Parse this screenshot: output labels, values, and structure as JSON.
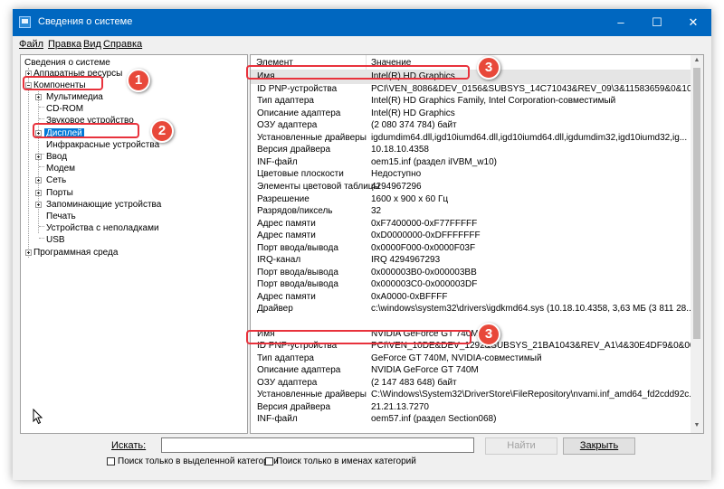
{
  "window": {
    "title": "Сведения о системе",
    "minimize": "–",
    "maximize": "☐",
    "close": "✕"
  },
  "menu": [
    {
      "label": "Файл"
    },
    {
      "label": "Правка"
    },
    {
      "label": "Вид"
    },
    {
      "label": "Справка"
    }
  ],
  "tree": {
    "root": "Сведения о системе",
    "hardware": "Аппаратные ресурсы",
    "components": "Компоненты",
    "multimedia": "Мультимедиа",
    "cdrom": "CD-ROM",
    "sound": "Звуковое устройство",
    "display": "Дисплей",
    "infrared": "Инфракрасные устройства",
    "input": "Ввод",
    "modem": "Модем",
    "network": "Сеть",
    "ports": "Порты",
    "storage": "Запоминающие устройства",
    "print": "Печать",
    "problem": "Устройства с неполадками",
    "usb": "USB",
    "software": "Программная среда"
  },
  "list": {
    "col_element": "Элемент",
    "col_value": "Значение",
    "rows": [
      {
        "k": "Имя",
        "v": "Intel(R) HD Graphics"
      },
      {
        "k": "ID PNP-устройства",
        "v": "PCI\\VEN_8086&DEV_0156&SUBSYS_14C71043&REV_09\\3&11583659&0&10"
      },
      {
        "k": "Тип адаптера",
        "v": "Intel(R) HD Graphics Family, Intel Corporation-совместимый"
      },
      {
        "k": "Описание адаптера",
        "v": "Intel(R) HD Graphics"
      },
      {
        "k": "ОЗУ адаптера",
        "v": "(2 080 374 784) байт"
      },
      {
        "k": "Установленные драйверы",
        "v": "igdumdim64.dll,igd10iumd64.dll,igd10iumd64.dll,igdumdim32,igd10iumd32,ig..."
      },
      {
        "k": "Версия драйвера",
        "v": "10.18.10.4358"
      },
      {
        "k": "INF-файл",
        "v": "oem15.inf (раздел iIVBM_w10)"
      },
      {
        "k": "Цветовые плоскости",
        "v": "Недоступно"
      },
      {
        "k": "Элементы цветовой таблицы",
        "v": "4294967296"
      },
      {
        "k": "Разрешение",
        "v": "1600 x 900 x 60 Гц"
      },
      {
        "k": "Разрядов/пиксель",
        "v": "32"
      },
      {
        "k": "Адрес памяти",
        "v": "0xF7400000-0xF77FFFFF"
      },
      {
        "k": "Адрес памяти",
        "v": "0xD0000000-0xDFFFFFFF"
      },
      {
        "k": "Порт ввода/вывода",
        "v": "0x0000F000-0x0000F03F"
      },
      {
        "k": "IRQ-канал",
        "v": "IRQ 4294967293"
      },
      {
        "k": "Порт ввода/вывода",
        "v": "0x000003B0-0x000003BB"
      },
      {
        "k": "Порт ввода/вывода",
        "v": "0x000003C0-0x000003DF"
      },
      {
        "k": "Адрес памяти",
        "v": "0xA0000-0xBFFFF"
      },
      {
        "k": "Драйвер",
        "v": "c:\\windows\\system32\\drivers\\igdkmd64.sys (10.18.10.4358, 3,63 МБ (3 811 28..."
      },
      {
        "k": "",
        "v": ""
      },
      {
        "k": "Имя",
        "v": "NVIDIA GeForce GT 740M"
      },
      {
        "k": "ID PNP-устройства",
        "v": "PCI\\VEN_10DE&DEV_1292&SUBSYS_21BA1043&REV_A1\\4&30E4DF9&0&0008"
      },
      {
        "k": "Тип адаптера",
        "v": "GeForce GT 740M, NVIDIA-совместимый"
      },
      {
        "k": "Описание адаптера",
        "v": "NVIDIA GeForce GT 740M"
      },
      {
        "k": "ОЗУ адаптера",
        "v": "(2 147 483 648) байт"
      },
      {
        "k": "Установленные драйверы",
        "v": "C:\\Windows\\System32\\DriverStore\\FileRepository\\nvami.inf_amd64_fd2cdd92c..."
      },
      {
        "k": "Версия драйвера",
        "v": "21.21.13.7270"
      },
      {
        "k": "INF-файл",
        "v": "oem57.inf (раздел Section068)"
      }
    ]
  },
  "search": {
    "label": "Искать:",
    "value": "",
    "find": "Найти",
    "close": "Закрыть"
  },
  "options": {
    "only_selected": "Поиск только в выделенной категории",
    "only_names": "Поиск только в именах категорий"
  },
  "annotations": {
    "n1": "1",
    "n2": "2",
    "n3a": "3",
    "n3b": "3"
  },
  "colors": {
    "accent": "#0067c0",
    "highlight": "#e8323c",
    "selection": "#0078d7"
  }
}
